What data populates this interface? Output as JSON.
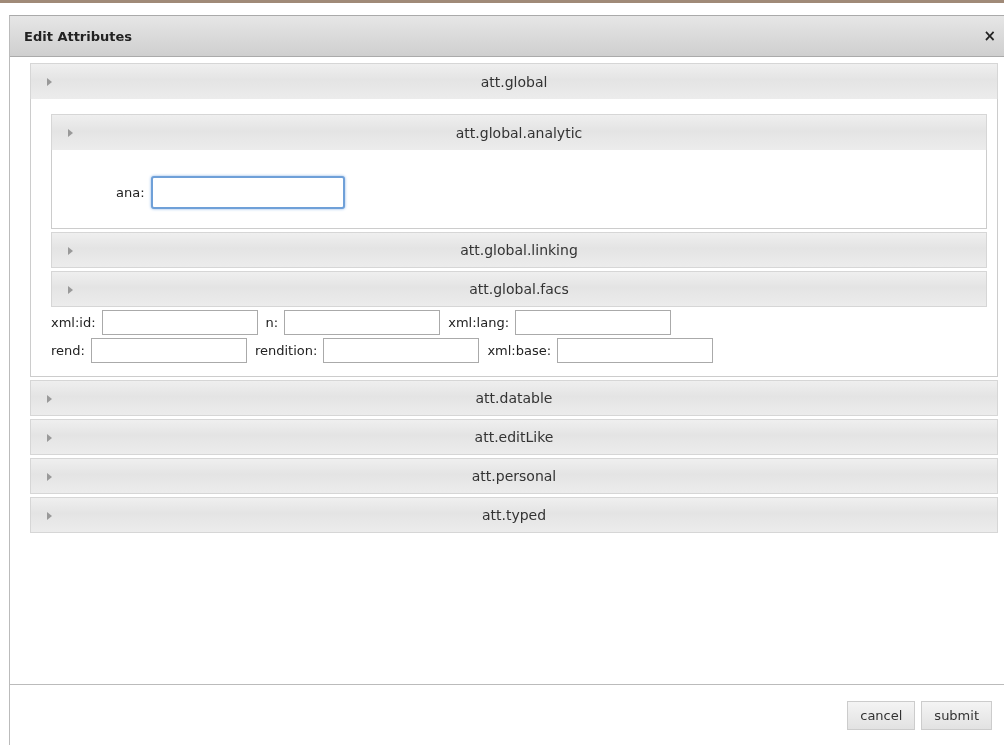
{
  "dialog": {
    "title": "Edit Attributes",
    "close": "×"
  },
  "sections": [
    {
      "label": "att.global",
      "expanded": true,
      "children": [
        {
          "label": "att.global.analytic",
          "expanded": true,
          "field_rows": [
            [
              {
                "label": "ana:",
                "focused": true
              }
            ]
          ]
        },
        {
          "label": "att.global.linking",
          "expanded": false
        },
        {
          "label": "att.global.facs",
          "expanded": false
        }
      ],
      "field_rows": [
        [
          {
            "label": "xml:id:",
            "focused": false
          },
          {
            "label": "n:",
            "focused": false
          },
          {
            "label": "xml:lang:",
            "focused": false
          }
        ],
        [
          {
            "label": "rend:",
            "focused": false
          },
          {
            "label": "rendition:",
            "focused": false
          },
          {
            "label": "xml:base:",
            "focused": false
          }
        ]
      ]
    },
    {
      "label": "att.datable",
      "expanded": false
    },
    {
      "label": "att.editLike",
      "expanded": false
    },
    {
      "label": "att.personal",
      "expanded": false
    },
    {
      "label": "att.typed",
      "expanded": false
    }
  ],
  "buttons": [
    "cancel",
    "submit"
  ]
}
